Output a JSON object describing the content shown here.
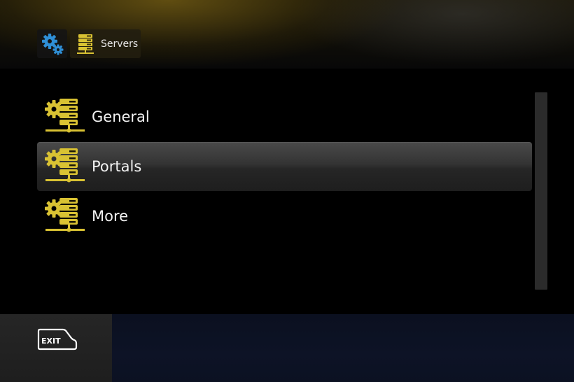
{
  "breadcrumb": {
    "settings_icon": "gears-icon",
    "current_icon": "server-stack-icon",
    "current_label": "Servers"
  },
  "menu": {
    "items": [
      {
        "label": "General",
        "icon": "server-gear-icon",
        "selected": false
      },
      {
        "label": "Portals",
        "icon": "server-gear-icon",
        "selected": true
      },
      {
        "label": "More",
        "icon": "server-gear-icon",
        "selected": false
      }
    ]
  },
  "footer": {
    "exit_label": "EXIT"
  },
  "colors": {
    "accent_yellow": "#d9c233",
    "settings_blue": "#2f8fd6",
    "selected_row": "#333333",
    "text": "#f2f2f2"
  }
}
